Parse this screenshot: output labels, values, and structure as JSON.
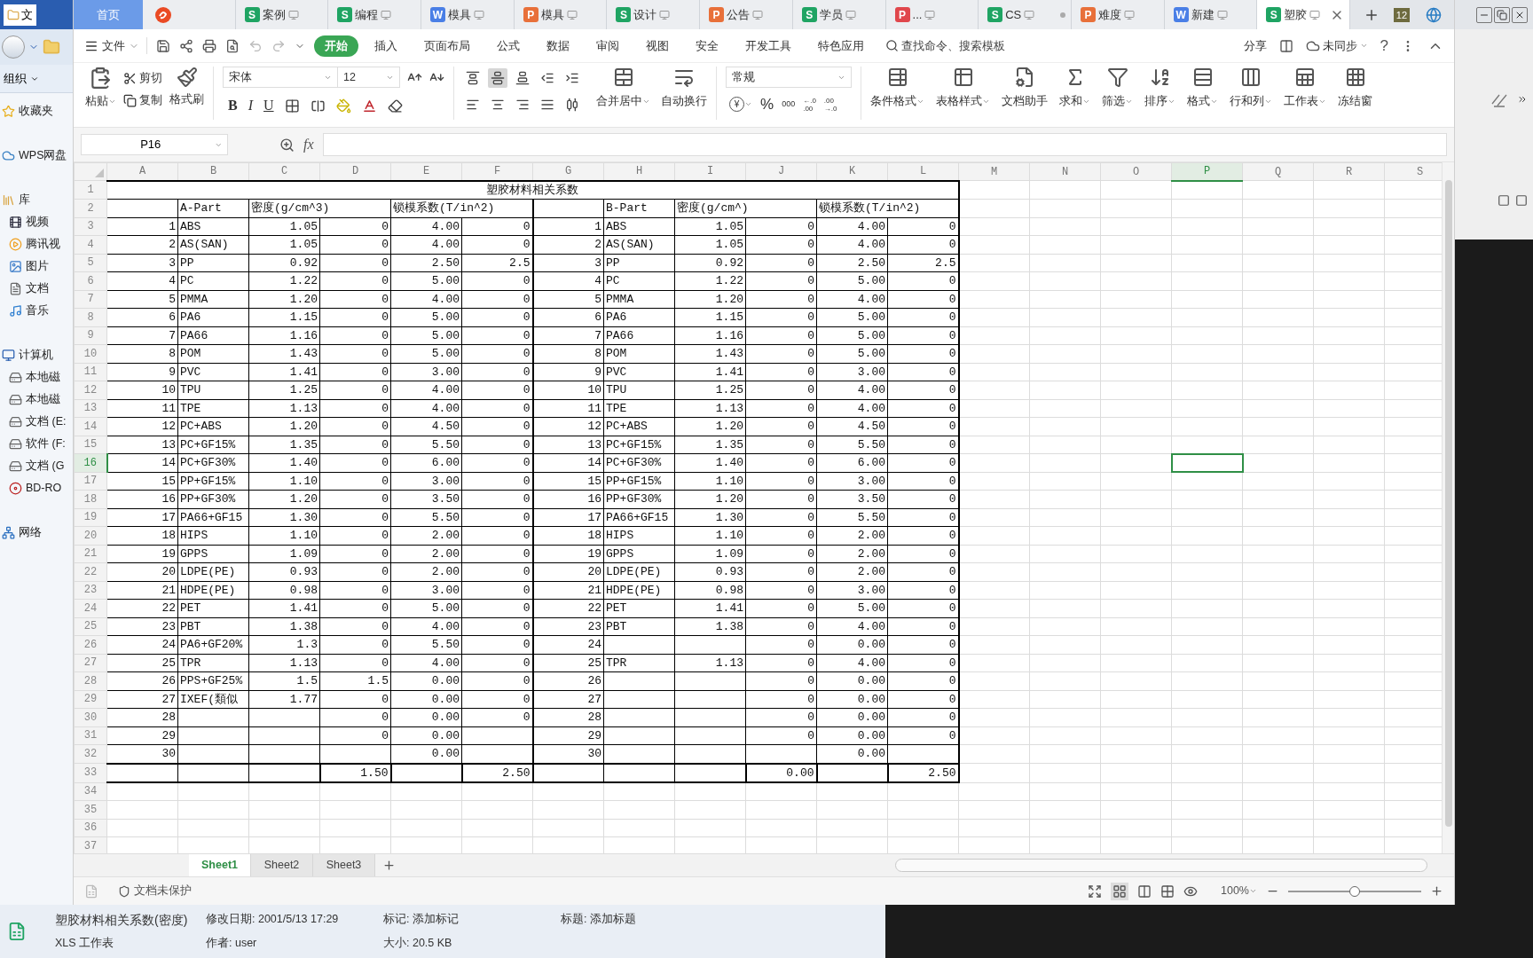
{
  "explorer": {
    "tab": "文",
    "organize": "组织",
    "nav": [
      {
        "label": "收藏夹",
        "kind": "heading"
      },
      {
        "label": "WPS网盘",
        "kind": "heading"
      },
      {
        "label": "库",
        "kind": "heading"
      },
      {
        "label": "视频",
        "kind": "item"
      },
      {
        "label": "腾讯视",
        "kind": "item"
      },
      {
        "label": "图片",
        "kind": "item"
      },
      {
        "label": "文档",
        "kind": "item"
      },
      {
        "label": "音乐",
        "kind": "item"
      },
      {
        "label": "计算机",
        "kind": "heading"
      },
      {
        "label": "本地磁",
        "kind": "item"
      },
      {
        "label": "本地磁",
        "kind": "item"
      },
      {
        "label": "文档 (E:",
        "kind": "item"
      },
      {
        "label": "软件 (F:",
        "kind": "item"
      },
      {
        "label": "文档 (G",
        "kind": "item"
      },
      {
        "label": "BD-RO",
        "kind": "item"
      },
      {
        "label": "网络",
        "kind": "heading"
      }
    ],
    "details": [
      [
        "塑胶材料相关系数(密度)",
        "修改日期: 2001/5/13 17:29",
        "标记: 添加标记",
        "标题: 添加标题"
      ],
      [
        "XLS 工作表",
        "作者: user",
        "大小: 20.5 KB"
      ]
    ]
  },
  "tabs": {
    "items": [
      {
        "kind": "home",
        "label": "首页",
        "selected": false
      },
      {
        "kind": "logo",
        "selected": false
      },
      {
        "kind": "doc",
        "badge": "S",
        "color": "#1fa463",
        "label": "案例",
        "selected": false,
        "modified": false
      },
      {
        "kind": "doc",
        "badge": "S",
        "color": "#1fa463",
        "label": "编程",
        "selected": false,
        "modified": false
      },
      {
        "kind": "doc",
        "badge": "W",
        "color": "#4a7fe6",
        "label": "模具",
        "selected": false,
        "modified": false
      },
      {
        "kind": "doc",
        "badge": "P",
        "color": "#e8703a",
        "label": "模具",
        "selected": false,
        "modified": false
      },
      {
        "kind": "doc",
        "badge": "S",
        "color": "#1fa463",
        "label": "设计",
        "selected": false,
        "modified": false
      },
      {
        "kind": "doc",
        "badge": "P",
        "color": "#e8703a",
        "label": "公告",
        "selected": false,
        "modified": false
      },
      {
        "kind": "doc",
        "badge": "S",
        "color": "#1fa463",
        "label": "学员",
        "selected": false,
        "modified": false
      },
      {
        "kind": "doc",
        "badge": "P",
        "color": "#e0474c",
        "label": "...",
        "selected": false,
        "modified": false
      },
      {
        "kind": "doc",
        "badge": "S",
        "color": "#1fa463",
        "label": "CS",
        "selected": false,
        "modified": true
      },
      {
        "kind": "doc",
        "badge": "P",
        "color": "#e8703a",
        "label": "难度",
        "selected": false,
        "modified": false
      },
      {
        "kind": "doc",
        "badge": "W",
        "color": "#4a7fe6",
        "label": "新建",
        "selected": false,
        "modified": false
      },
      {
        "kind": "doc",
        "badge": "S",
        "color": "#1fa463",
        "label": "塑胶",
        "selected": true,
        "modified": false
      }
    ],
    "notice_count": "12"
  },
  "menu": {
    "file": "文件",
    "tabs": [
      {
        "label": "开始",
        "selected": true
      },
      {
        "label": "插入",
        "selected": false
      },
      {
        "label": "页面布局",
        "selected": false
      },
      {
        "label": "公式",
        "selected": false
      },
      {
        "label": "数据",
        "selected": false
      },
      {
        "label": "审阅",
        "selected": false
      },
      {
        "label": "视图",
        "selected": false
      },
      {
        "label": "安全",
        "selected": false
      },
      {
        "label": "开发工具",
        "selected": false
      },
      {
        "label": "特色应用",
        "selected": false
      }
    ],
    "search": "查找命令、搜索模板",
    "share": "分享",
    "sync": "未同步",
    "help": "?"
  },
  "ribbon": {
    "paste": "粘贴",
    "cut": "剪切",
    "copy": "复制",
    "painter": "格式刷",
    "font": "宋体",
    "size": "12",
    "bold": "B",
    "italic": "I",
    "underline": "U",
    "align_buttons": [
      {
        "selected": false
      },
      {
        "selected": true
      },
      {
        "selected": false
      },
      {
        "selected": false
      },
      {
        "selected": false
      },
      {
        "selected": false
      },
      {
        "selected": false
      },
      {
        "selected": false
      },
      {
        "selected": false
      },
      {
        "selected": false
      }
    ],
    "merge": "合并居中",
    "wrap": "自动换行",
    "number_format": "常规",
    "currency": "¥",
    "percent": "%",
    "thousands": "000",
    "decimal_add": [
      "←.0",
      ".00"
    ],
    "decimal_remove": [
      ".00",
      "→.0"
    ],
    "tools": [
      "条件格式",
      "表格样式",
      "文档助手",
      "求和",
      "筛选",
      "排序",
      "格式",
      "行和列",
      "工作表",
      "冻结窗"
    ]
  },
  "formula_bar": {
    "name_box": "P16",
    "fx": "fx"
  },
  "sheet": {
    "columns": [
      {
        "label": "A",
        "selected": false
      },
      {
        "label": "B",
        "selected": false
      },
      {
        "label": "C",
        "selected": false
      },
      {
        "label": "D",
        "selected": false
      },
      {
        "label": "E",
        "selected": false
      },
      {
        "label": "F",
        "selected": false
      },
      {
        "label": "G",
        "selected": false
      },
      {
        "label": "H",
        "selected": false
      },
      {
        "label": "I",
        "selected": false
      },
      {
        "label": "J",
        "selected": false
      },
      {
        "label": "K",
        "selected": false
      },
      {
        "label": "L",
        "selected": false
      },
      {
        "label": "M",
        "selected": false
      },
      {
        "label": "N",
        "selected": false
      },
      {
        "label": "O",
        "selected": false
      },
      {
        "label": "P",
        "selected": true
      },
      {
        "label": "Q",
        "selected": false
      },
      {
        "label": "R",
        "selected": false
      },
      {
        "label": "S",
        "selected": false
      }
    ],
    "rows": [
      {
        "label": "1",
        "selected": false,
        "title": "塑胶材料相关系数"
      },
      {
        "label": "2",
        "selected": false,
        "headers": [
          {
            "kind": "single"
          },
          {
            "kind": "single",
            "text": "A-Part"
          },
          {
            "kind": "double",
            "text": "密度(g/cm^3)"
          },
          {
            "kind": "double",
            "text": "锁模系数(T/in^2)"
          },
          {
            "kind": "single"
          },
          {
            "kind": "single",
            "text": "B-Part"
          },
          {
            "kind": "double",
            "text": "密度(g/cm^)"
          },
          {
            "kind": "double",
            "text": "锁模系数(T/in^2)"
          }
        ]
      },
      {
        "label": "3",
        "selected": false,
        "cells": [
          "1",
          "ABS",
          "1.05",
          "0",
          "4.00",
          "0",
          "1",
          "ABS",
          "1.05",
          "0",
          "4.00",
          "0"
        ]
      },
      {
        "label": "4",
        "selected": false,
        "cells": [
          "2",
          "AS(SAN)",
          "1.05",
          "0",
          "4.00",
          "0",
          "2",
          "AS(SAN)",
          "1.05",
          "0",
          "4.00",
          "0"
        ]
      },
      {
        "label": "5",
        "selected": false,
        "cells": [
          "3",
          "PP",
          "0.92",
          "0",
          "2.50",
          "2.5",
          "3",
          "PP",
          "0.92",
          "0",
          "2.50",
          "2.5"
        ]
      },
      {
        "label": "6",
        "selected": false,
        "cells": [
          "4",
          "PC",
          "1.22",
          "0",
          "5.00",
          "0",
          "4",
          "PC",
          "1.22",
          "0",
          "5.00",
          "0"
        ]
      },
      {
        "label": "7",
        "selected": false,
        "cells": [
          "5",
          "PMMA",
          "1.20",
          "0",
          "4.00",
          "0",
          "5",
          "PMMA",
          "1.20",
          "0",
          "4.00",
          "0"
        ]
      },
      {
        "label": "8",
        "selected": false,
        "cells": [
          "6",
          "PA6",
          "1.15",
          "0",
          "5.00",
          "0",
          "6",
          "PA6",
          "1.15",
          "0",
          "5.00",
          "0"
        ]
      },
      {
        "label": "9",
        "selected": false,
        "cells": [
          "7",
          "PA66",
          "1.16",
          "0",
          "5.00",
          "0",
          "7",
          "PA66",
          "1.16",
          "0",
          "5.00",
          "0"
        ]
      },
      {
        "label": "10",
        "selected": false,
        "cells": [
          "8",
          "POM",
          "1.43",
          "0",
          "5.00",
          "0",
          "8",
          "POM",
          "1.43",
          "0",
          "5.00",
          "0"
        ]
      },
      {
        "label": "11",
        "selected": false,
        "cells": [
          "9",
          "PVC",
          "1.41",
          "0",
          "3.00",
          "0",
          "9",
          "PVC",
          "1.41",
          "0",
          "3.00",
          "0"
        ]
      },
      {
        "label": "12",
        "selected": false,
        "cells": [
          "10",
          "TPU",
          "1.25",
          "0",
          "4.00",
          "0",
          "10",
          "TPU",
          "1.25",
          "0",
          "4.00",
          "0"
        ]
      },
      {
        "label": "13",
        "selected": false,
        "cells": [
          "11",
          "TPE",
          "1.13",
          "0",
          "4.00",
          "0",
          "11",
          "TPE",
          "1.13",
          "0",
          "4.00",
          "0"
        ]
      },
      {
        "label": "14",
        "selected": false,
        "cells": [
          "12",
          "PC+ABS",
          "1.20",
          "0",
          "4.50",
          "0",
          "12",
          "PC+ABS",
          "1.20",
          "0",
          "4.50",
          "0"
        ]
      },
      {
        "label": "15",
        "selected": false,
        "cells": [
          "13",
          "PC+GF15%",
          "1.35",
          "0",
          "5.50",
          "0",
          "13",
          "PC+GF15%",
          "1.35",
          "0",
          "5.50",
          "0"
        ]
      },
      {
        "label": "16",
        "selected": true,
        "cells": [
          "14",
          "PC+GF30%",
          "1.40",
          "0",
          "6.00",
          "0",
          "14",
          "PC+GF30%",
          "1.40",
          "0",
          "6.00",
          "0"
        ]
      },
      {
        "label": "17",
        "selected": false,
        "cells": [
          "15",
          "PP+GF15%",
          "1.10",
          "0",
          "3.00",
          "0",
          "15",
          "PP+GF15%",
          "1.10",
          "0",
          "3.00",
          "0"
        ]
      },
      {
        "label": "18",
        "selected": false,
        "cells": [
          "16",
          "PP+GF30%",
          "1.20",
          "0",
          "3.50",
          "0",
          "16",
          "PP+GF30%",
          "1.20",
          "0",
          "3.50",
          "0"
        ]
      },
      {
        "label": "19",
        "selected": false,
        "cells": [
          "17",
          "PA66+GF15",
          "1.30",
          "0",
          "5.50",
          "0",
          "17",
          "PA66+GF15",
          "1.30",
          "0",
          "5.50",
          "0"
        ]
      },
      {
        "label": "20",
        "selected": false,
        "cells": [
          "18",
          "HIPS",
          "1.10",
          "0",
          "2.00",
          "0",
          "18",
          "HIPS",
          "1.10",
          "0",
          "2.00",
          "0"
        ]
      },
      {
        "label": "21",
        "selected": false,
        "cells": [
          "19",
          "GPPS",
          "1.09",
          "0",
          "2.00",
          "0",
          "19",
          "GPPS",
          "1.09",
          "0",
          "2.00",
          "0"
        ]
      },
      {
        "label": "22",
        "selected": false,
        "cells": [
          "20",
          "LDPE(PE)",
          "0.93",
          "0",
          "2.00",
          "0",
          "20",
          "LDPE(PE)",
          "0.93",
          "0",
          "2.00",
          "0"
        ]
      },
      {
        "label": "23",
        "selected": false,
        "cells": [
          "21",
          "HDPE(PE)",
          "0.98",
          "0",
          "3.00",
          "0",
          "21",
          "HDPE(PE)",
          "0.98",
          "0",
          "3.00",
          "0"
        ]
      },
      {
        "label": "24",
        "selected": false,
        "cells": [
          "22",
          "PET",
          "1.41",
          "0",
          "5.00",
          "0",
          "22",
          "PET",
          "1.41",
          "0",
          "5.00",
          "0"
        ]
      },
      {
        "label": "25",
        "selected": false,
        "cells": [
          "23",
          "PBT",
          "1.38",
          "0",
          "4.00",
          "0",
          "23",
          "PBT",
          "1.38",
          "0",
          "4.00",
          "0"
        ]
      },
      {
        "label": "26",
        "selected": false,
        "cells": [
          "24",
          "PA6+GF20%",
          "1.3",
          "0",
          "5.50",
          "0",
          "24",
          null,
          null,
          "0",
          "0.00",
          "0"
        ]
      },
      {
        "label": "27",
        "selected": false,
        "cells": [
          "25",
          "TPR",
          "1.13",
          "0",
          "4.00",
          "0",
          "25",
          "TPR",
          "1.13",
          "0",
          "4.00",
          "0"
        ]
      },
      {
        "label": "28",
        "selected": false,
        "cells": [
          "26",
          "PPS+GF25%",
          "1.5",
          "1.5",
          "0.00",
          "0",
          "26",
          null,
          null,
          "0",
          "0.00",
          "0"
        ]
      },
      {
        "label": "29",
        "selected": false,
        "cells": [
          "27",
          "IXEF(類似",
          "1.77",
          "0",
          "0.00",
          "0",
          "27",
          null,
          null,
          "0",
          "0.00",
          "0"
        ]
      },
      {
        "label": "30",
        "selected": false,
        "cells": [
          "28",
          null,
          null,
          "0",
          "0.00",
          "0",
          "28",
          null,
          null,
          "0",
          "0.00",
          "0"
        ]
      },
      {
        "label": "31",
        "selected": false,
        "cells": [
          "29",
          null,
          null,
          "0",
          "0.00",
          null,
          "29",
          null,
          null,
          "0",
          "0.00",
          "0"
        ]
      },
      {
        "label": "32",
        "selected": false,
        "cells": [
          "30",
          null,
          null,
          null,
          "0.00",
          null,
          "30",
          null,
          null,
          null,
          "0.00",
          null
        ]
      },
      {
        "label": "33",
        "selected": false,
        "kind": "total",
        "cells": [
          null,
          null,
          null,
          "1.50",
          null,
          "2.50",
          null,
          null,
          null,
          "0.00",
          null,
          "2.50"
        ]
      },
      {
        "label": "34",
        "selected": false
      },
      {
        "label": "35",
        "selected": false
      },
      {
        "label": "36",
        "selected": false
      },
      {
        "label": "37",
        "selected": false
      }
    ]
  },
  "sheet_tabs": [
    {
      "label": "Sheet1",
      "selected": true
    },
    {
      "label": "Sheet2",
      "selected": false
    },
    {
      "label": "Sheet3",
      "selected": false
    }
  ],
  "status": {
    "protect": "文档未保护",
    "zoom": "100%",
    "level": 0.5
  }
}
